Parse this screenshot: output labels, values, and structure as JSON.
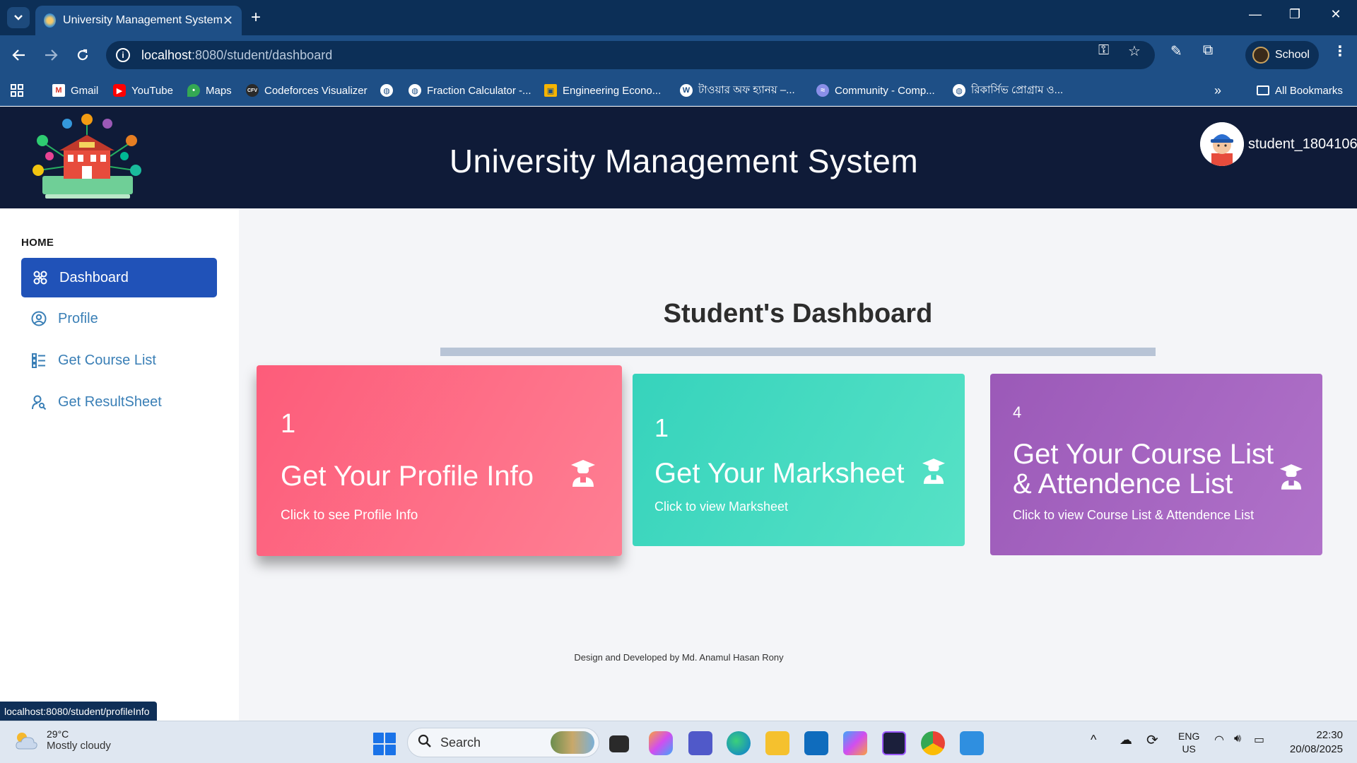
{
  "browser": {
    "tab_title": "University Management System",
    "url_host": "localhost",
    "url_path": ":8080/student/dashboard",
    "profile_label": "School",
    "bookmarks": [
      {
        "label": "Gmail"
      },
      {
        "label": "YouTube"
      },
      {
        "label": "Maps"
      },
      {
        "label": "Codeforces Visualizer"
      },
      {
        "label": ""
      },
      {
        "label": "Fraction Calculator -..."
      },
      {
        "label": "Engineering Econo..."
      },
      {
        "label": "টাওয়ার অফ হ্যানয় –..."
      },
      {
        "label": "Community - Comp..."
      },
      {
        "label": "রিকার্সিভ প্রোগ্রাম ও..."
      }
    ],
    "all_bookmarks": "All Bookmarks",
    "status_url": "localhost:8080/student/profileInfo"
  },
  "header": {
    "title": "University Management System",
    "username": "student_1804106"
  },
  "sidebar": {
    "section": "HOME",
    "items": [
      {
        "label": "Dashboard",
        "icon": "dashboard-icon",
        "active": true
      },
      {
        "label": "Profile",
        "icon": "profile-icon",
        "active": false
      },
      {
        "label": "Get Course List",
        "icon": "list-icon",
        "active": false
      },
      {
        "label": "Get ResultSheet",
        "icon": "user-search-icon",
        "active": false
      }
    ]
  },
  "main": {
    "title": "Student's Dashboard",
    "cards": [
      {
        "count": "1",
        "title": "Get Your Profile Info",
        "subtitle": "Click to see Profile Info",
        "color": "#fd5c7a"
      },
      {
        "count": "1",
        "title": "Get Your Marksheet",
        "subtitle": "Click to view Marksheet",
        "color": "#36d3bc"
      },
      {
        "count": "4",
        "title": "Get Your Course List & Attendence List",
        "subtitle": "Click to view Course List & Attendence List",
        "color": "#9b59b8"
      }
    ],
    "credit": "Design and Developed by Md. Anamul Hasan Rony"
  },
  "taskbar": {
    "temperature": "29°C",
    "weather": "Mostly cloudy",
    "search_placeholder": "Search",
    "lang_top": "ENG",
    "lang_bottom": "US",
    "time": "22:30",
    "date": "20/08/2025"
  },
  "colors": {
    "header_bg": "#0f1b38",
    "active_nav": "#2052b8",
    "nav_text": "#3a7fb6",
    "chrome_toolbar": "#1e4f86"
  }
}
